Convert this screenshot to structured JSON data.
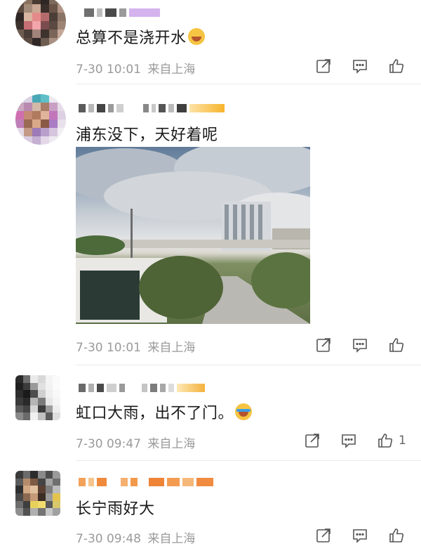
{
  "comments": [
    {
      "text": "总算不是浇开水",
      "emoji": "laughing-crying-emoji",
      "time": "7-30 10:01",
      "location": "来自上海",
      "likes": ""
    },
    {
      "text": "浦东没下，天好着呢",
      "time": "7-30 10:01",
      "location": "来自上海",
      "likes": "",
      "photo": "city-cloudy-sky-photo"
    },
    {
      "text": "虹口大雨，出不了门。",
      "emoji": "crying-emoji",
      "time": "7-30 09:47",
      "location": "来自上海",
      "likes": "1"
    },
    {
      "text": "长宁雨好大",
      "time": "7-30 09:48",
      "location": "来自上海",
      "likes": ""
    }
  ],
  "icons": [
    "share-icon",
    "comment-icon",
    "like-icon"
  ],
  "colors": {
    "meta_text": "#9a9a9a",
    "body_text": "#1a1a1a",
    "icon": "#555555"
  }
}
